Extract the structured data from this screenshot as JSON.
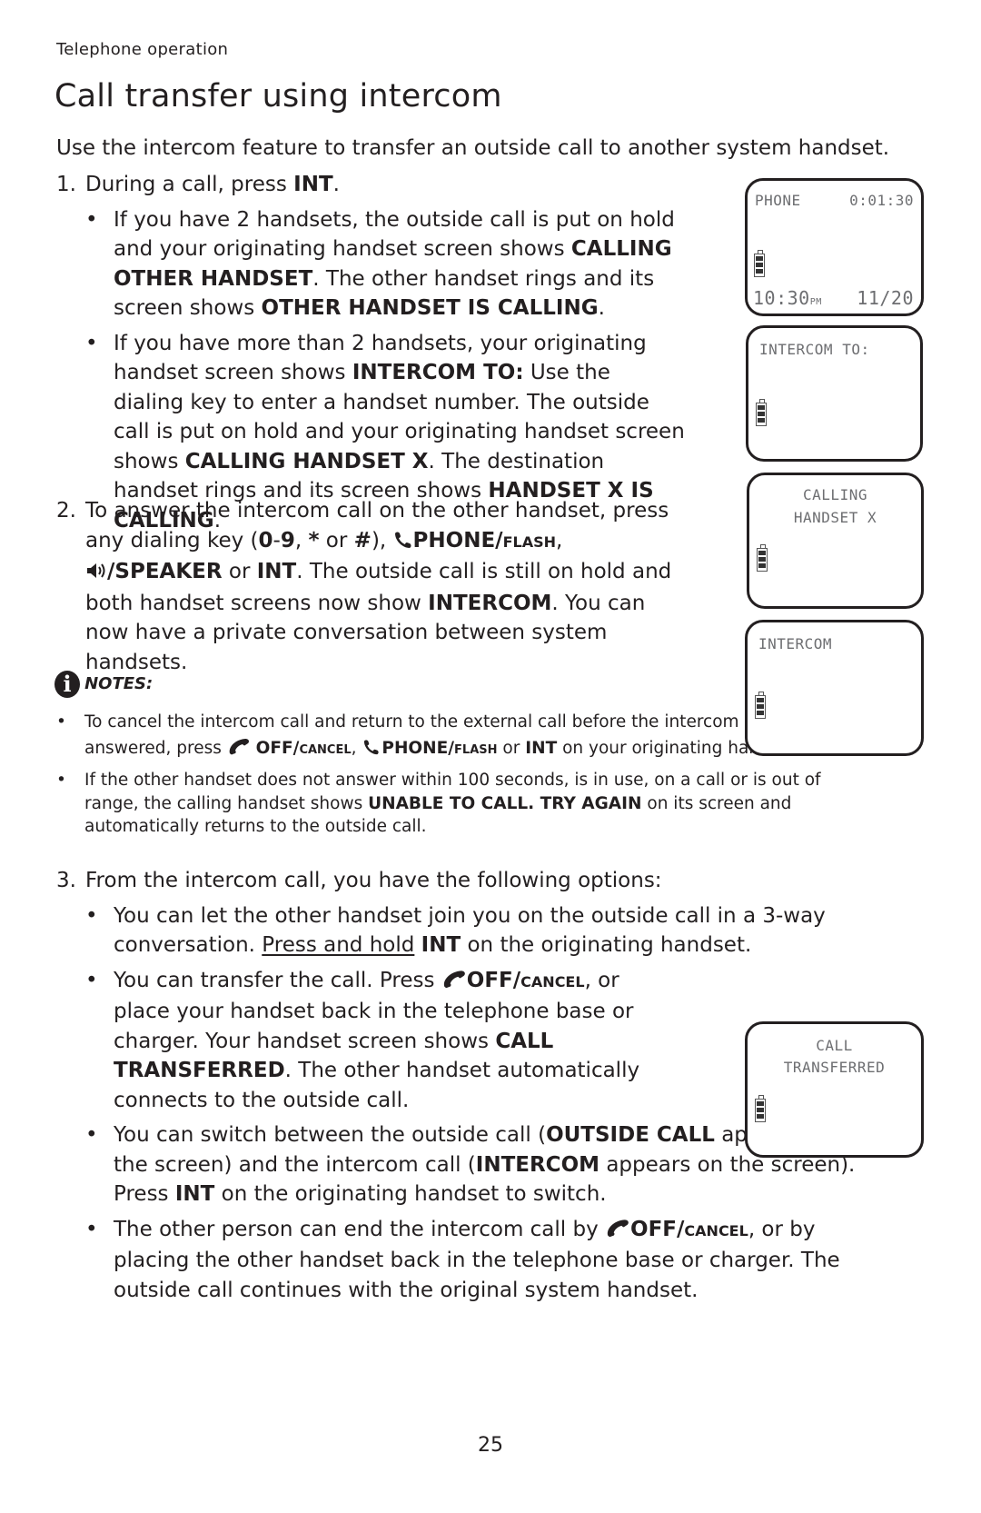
{
  "header": {
    "section": "Telephone operation",
    "title": "Call transfer using intercom"
  },
  "intro": "Use the intercom feature to transfer an outside call to another system handset.",
  "steps": {
    "s1": {
      "num": "1.",
      "lead": "During a call, press ",
      "lead_bold": "INT",
      "lead_end": ".",
      "b1": {
        "t1": "If you have 2 handsets, the outside call is put on hold and your originating handset screen shows ",
        "k1": "CALLING OTHER HANDSET",
        "t2": ". The other handset rings and its screen shows ",
        "k2": "OTHER HANDSET IS CALLING",
        "t3": "."
      },
      "b2": {
        "t1": "If you have more than 2 handsets, your originating handset screen shows ",
        "k1": "INTERCOM TO:",
        "t2": " Use the dialing key to enter a handset number. The outside call is put on hold and your originating handset screen shows ",
        "k2": "CALLING HANDSET X",
        "t3": ". The destination handset rings and its screen shows ",
        "k3": "HANDSET X IS CALLING",
        "t4": "."
      }
    },
    "s2": {
      "num": "2.",
      "t1": "To answer the intercom call on the other handset, press any dialing key (",
      "k1": "0",
      "t2": "-",
      "k2": "9",
      "t3": ", ",
      "k3": "*",
      "t4": " or ",
      "k4": "#",
      "t5": "), ",
      "k5": "PHONE/",
      "k5sc": "flash",
      "t6": ", ",
      "k6": "/SPEAKER",
      "t7": " or ",
      "k7": "INT",
      "t8": ". The outside call is still on hold and both handset screens now show ",
      "k8": "INTERCOM",
      "t9": ". You can now have a private conversation between system handsets."
    },
    "s3": {
      "num": "3.",
      "lead": "From the intercom call, you have the following options:",
      "b1": {
        "t1": "You can let the other handset join you on the outside call in a 3-way conversation. ",
        "u1": "Press and hold",
        "t2": " ",
        "k1": "INT",
        "t3": " on the originating handset."
      },
      "b2": {
        "t1": "You can transfer the call. Press ",
        "k1": "OFF/",
        "k1sc": "cancel",
        "t2": ", or place your handset back in the telephone base or charger. Your handset screen shows ",
        "k2": "CALL TRANSFERRED",
        "t3": ". The other handset automatically connects to the outside call."
      },
      "b3": {
        "t1": "You can switch between the outside call (",
        "k1": "OUTSIDE CALL",
        "t2": " appears on the screen) and the intercom call (",
        "k2": "INTERCOM",
        "t3": " appears on the screen). Press ",
        "k3": "INT",
        "t4": " on the originating handset to switch."
      },
      "b4": {
        "t1": "The other person can end the intercom call by ",
        "k1": "OFF/",
        "k1sc": "cancel",
        "t2": ", or by placing the other handset back in the telephone base or charger. The outside call continues with the original system handset."
      }
    }
  },
  "notes": {
    "label": "NOTES:",
    "n1": {
      "t1": "To cancel the intercom call and return to the external call before the intercom call is answered, press ",
      "k1": "OFF/",
      "k1sc": "cancel",
      "t2": ", ",
      "k2": "PHONE/",
      "k2sc": "flash",
      "t3": " or ",
      "k3": "INT",
      "t4": " on your originating handset."
    },
    "n2": {
      "t1": "If the other handset does not answer within 100 seconds, is in use, on a call or is out of range, the calling handset shows ",
      "k1": "UNABLE TO CALL. TRY AGAIN",
      "t2": " on its screen and automatically returns to the outside call."
    }
  },
  "screens": {
    "phone": {
      "top_left": "PHONE",
      "top_right": "0:01:30",
      "time": "10:30",
      "ampm": "PM",
      "date": "11/20"
    },
    "intercom_to": {
      "line1": "INTERCOM TO:"
    },
    "calling_handset": {
      "line1": "CALLING",
      "line2": "HANDSET X"
    },
    "intercom": {
      "line1": "INTERCOM"
    },
    "call_transferred": {
      "line1": "CALL",
      "line2": "TRANSFERRED"
    }
  },
  "footer": {
    "page_number": "25"
  }
}
